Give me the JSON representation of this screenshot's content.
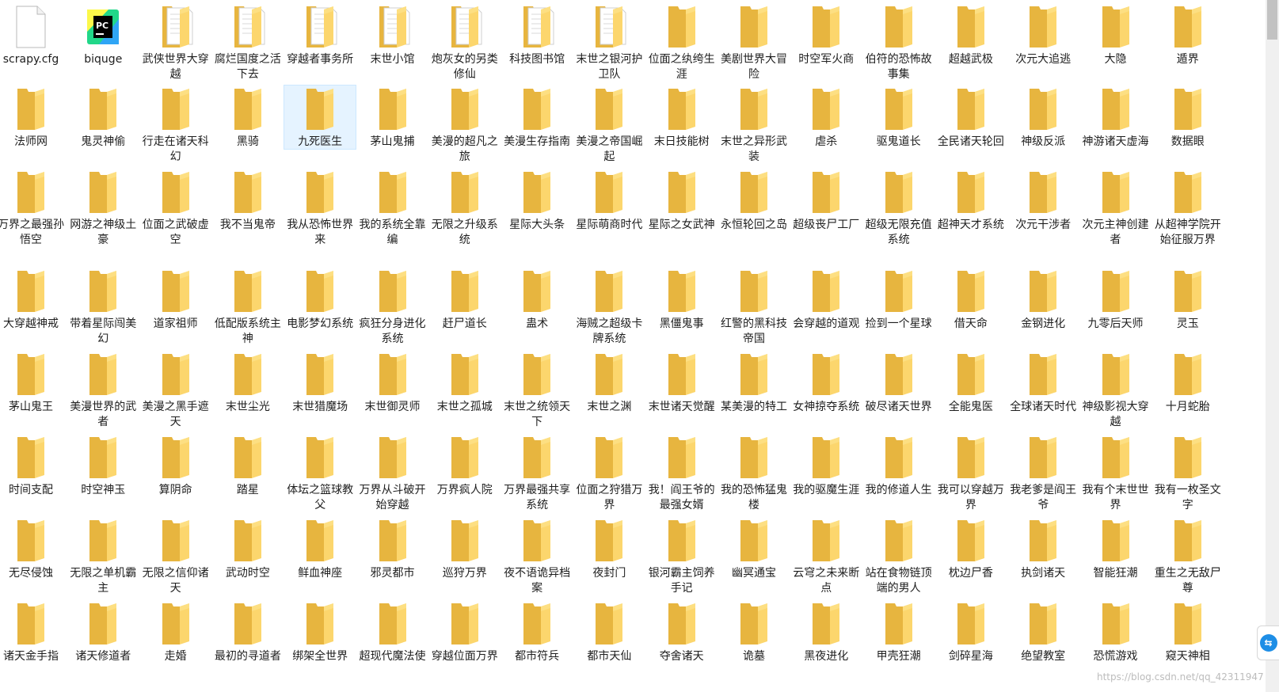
{
  "colors": {
    "folder_back": "#e7b53f",
    "folder_front": "#fcd66d",
    "folder_front_light": "#fde28b",
    "paper": "#ffffff",
    "selection": "#e5f3ff"
  },
  "items": [
    {
      "label": "scrapy.cfg",
      "type": "file"
    },
    {
      "label": "biquge",
      "type": "app"
    },
    {
      "label": "武侠世界大穿越",
      "type": "folder-doc"
    },
    {
      "label": "腐烂国度之活下去",
      "type": "folder-doc"
    },
    {
      "label": "穿越者事务所",
      "type": "folder-doc"
    },
    {
      "label": "末世小馆",
      "type": "folder-doc"
    },
    {
      "label": "炮灰女的另类修仙",
      "type": "folder-doc"
    },
    {
      "label": "科技图书馆",
      "type": "folder-doc"
    },
    {
      "label": "末世之银河护卫队",
      "type": "folder-doc"
    },
    {
      "label": "位面之纨绔生涯",
      "type": "folder"
    },
    {
      "label": "美剧世界大冒险",
      "type": "folder"
    },
    {
      "label": "时空军火商",
      "type": "folder"
    },
    {
      "label": "伯符的恐怖故事集",
      "type": "folder"
    },
    {
      "label": "超越武极",
      "type": "folder"
    },
    {
      "label": "次元大追逃",
      "type": "folder"
    },
    {
      "label": "大隐",
      "type": "folder"
    },
    {
      "label": "遁界",
      "type": "folder"
    },
    {
      "label": "法师网",
      "type": "folder"
    },
    {
      "label": "鬼灵神偷",
      "type": "folder"
    },
    {
      "label": "行走在诸天科幻",
      "type": "folder"
    },
    {
      "label": "黑骑",
      "type": "folder"
    },
    {
      "label": "九死医生",
      "type": "folder",
      "selected": true
    },
    {
      "label": "茅山鬼捕",
      "type": "folder"
    },
    {
      "label": "美漫的超凡之旅",
      "type": "folder"
    },
    {
      "label": "美漫生存指南",
      "type": "folder"
    },
    {
      "label": "美漫之帝国崛起",
      "type": "folder"
    },
    {
      "label": "末日技能树",
      "type": "folder"
    },
    {
      "label": "末世之异形武装",
      "type": "folder"
    },
    {
      "label": "虐杀",
      "type": "folder"
    },
    {
      "label": "驱鬼道长",
      "type": "folder"
    },
    {
      "label": "全民诸天轮回",
      "type": "folder"
    },
    {
      "label": "神级反派",
      "type": "folder"
    },
    {
      "label": "神游诸天虚海",
      "type": "folder"
    },
    {
      "label": "数据眼",
      "type": "folder"
    },
    {
      "label": "万界之最强孙悟空",
      "type": "folder"
    },
    {
      "label": "网游之神级土豪",
      "type": "folder"
    },
    {
      "label": "位面之武破虚空",
      "type": "folder"
    },
    {
      "label": "我不当鬼帝",
      "type": "folder"
    },
    {
      "label": "我从恐怖世界来",
      "type": "folder"
    },
    {
      "label": "我的系统全靠编",
      "type": "folder"
    },
    {
      "label": "无限之升级系统",
      "type": "folder"
    },
    {
      "label": "星际大头条",
      "type": "folder"
    },
    {
      "label": "星际萌商时代",
      "type": "folder"
    },
    {
      "label": "星际之女武神",
      "type": "folder"
    },
    {
      "label": "永恒轮回之岛",
      "type": "folder"
    },
    {
      "label": "超级丧尸工厂",
      "type": "folder"
    },
    {
      "label": "超级无限充值系统",
      "type": "folder"
    },
    {
      "label": "超神天才系统",
      "type": "folder"
    },
    {
      "label": "次元干涉者",
      "type": "folder"
    },
    {
      "label": "次元主神创建者",
      "type": "folder"
    },
    {
      "label": "从超神学院开始征服万界",
      "type": "folder"
    },
    {
      "label": "大穿越神戒",
      "type": "folder"
    },
    {
      "label": "带着星际闯美幻",
      "type": "folder"
    },
    {
      "label": "道家祖师",
      "type": "folder"
    },
    {
      "label": "低配版系统主神",
      "type": "folder"
    },
    {
      "label": "电影梦幻系统",
      "type": "folder"
    },
    {
      "label": "疯狂分身进化系统",
      "type": "folder"
    },
    {
      "label": "赶尸道长",
      "type": "folder"
    },
    {
      "label": "蛊术",
      "type": "folder"
    },
    {
      "label": "海贼之超级卡牌系统",
      "type": "folder"
    },
    {
      "label": "黑僵鬼事",
      "type": "folder"
    },
    {
      "label": "红警的黑科技帝国",
      "type": "folder"
    },
    {
      "label": "会穿越的道观",
      "type": "folder"
    },
    {
      "label": "捡到一个星球",
      "type": "folder"
    },
    {
      "label": "借天命",
      "type": "folder"
    },
    {
      "label": "金钢进化",
      "type": "folder"
    },
    {
      "label": "九零后天师",
      "type": "folder"
    },
    {
      "label": "灵玉",
      "type": "folder"
    },
    {
      "label": "茅山鬼王",
      "type": "folder"
    },
    {
      "label": "美漫世界的武者",
      "type": "folder"
    },
    {
      "label": "美漫之黑手遮天",
      "type": "folder"
    },
    {
      "label": "末世尘光",
      "type": "folder"
    },
    {
      "label": "末世猎魔场",
      "type": "folder"
    },
    {
      "label": "末世御灵师",
      "type": "folder"
    },
    {
      "label": "末世之孤城",
      "type": "folder"
    },
    {
      "label": "末世之统领天下",
      "type": "folder"
    },
    {
      "label": "末世之渊",
      "type": "folder"
    },
    {
      "label": "末世诸天觉醒",
      "type": "folder"
    },
    {
      "label": "某美漫的特工",
      "type": "folder"
    },
    {
      "label": "女神掠夺系统",
      "type": "folder"
    },
    {
      "label": "破尽诸天世界",
      "type": "folder"
    },
    {
      "label": "全能鬼医",
      "type": "folder"
    },
    {
      "label": "全球诸天时代",
      "type": "folder"
    },
    {
      "label": "神级影视大穿越",
      "type": "folder"
    },
    {
      "label": "十月蛇胎",
      "type": "folder"
    },
    {
      "label": "时间支配",
      "type": "folder"
    },
    {
      "label": "时空神玉",
      "type": "folder"
    },
    {
      "label": "算阴命",
      "type": "folder"
    },
    {
      "label": "踏星",
      "type": "folder"
    },
    {
      "label": "体坛之篮球教父",
      "type": "folder"
    },
    {
      "label": "万界从斗破开始穿越",
      "type": "folder"
    },
    {
      "label": "万界疯人院",
      "type": "folder"
    },
    {
      "label": "万界最强共享系统",
      "type": "folder"
    },
    {
      "label": "位面之狩猎万界",
      "type": "folder"
    },
    {
      "label": "我！阎王爷的最强女婿",
      "type": "folder"
    },
    {
      "label": "我的恐怖猛鬼楼",
      "type": "folder"
    },
    {
      "label": "我的驱魔生涯",
      "type": "folder"
    },
    {
      "label": "我的修道人生",
      "type": "folder"
    },
    {
      "label": "我可以穿越万界",
      "type": "folder"
    },
    {
      "label": "我老爹是阎王爷",
      "type": "folder"
    },
    {
      "label": "我有个末世世界",
      "type": "folder"
    },
    {
      "label": "我有一枚圣文字",
      "type": "folder"
    },
    {
      "label": "无尽侵蚀",
      "type": "folder"
    },
    {
      "label": "无限之单机霸主",
      "type": "folder"
    },
    {
      "label": "无限之信仰诸天",
      "type": "folder"
    },
    {
      "label": "武动时空",
      "type": "folder"
    },
    {
      "label": "鲜血神座",
      "type": "folder"
    },
    {
      "label": "邪灵都市",
      "type": "folder"
    },
    {
      "label": "巡狩万界",
      "type": "folder"
    },
    {
      "label": "夜不语诡异档案",
      "type": "folder"
    },
    {
      "label": "夜封门",
      "type": "folder"
    },
    {
      "label": "银河霸主饲养手记",
      "type": "folder"
    },
    {
      "label": "幽冥通宝",
      "type": "folder"
    },
    {
      "label": "云穹之未来断点",
      "type": "folder"
    },
    {
      "label": "站在食物链顶端的男人",
      "type": "folder"
    },
    {
      "label": "枕边尸香",
      "type": "folder"
    },
    {
      "label": "执剑诸天",
      "type": "folder"
    },
    {
      "label": "智能狂潮",
      "type": "folder"
    },
    {
      "label": "重生之无敌尸尊",
      "type": "folder"
    },
    {
      "label": "诸天金手指",
      "type": "folder"
    },
    {
      "label": "诸天修道者",
      "type": "folder"
    },
    {
      "label": "走婚",
      "type": "folder"
    },
    {
      "label": "最初的寻道者",
      "type": "folder"
    },
    {
      "label": "绑架全世界",
      "type": "folder"
    },
    {
      "label": "超现代魔法使",
      "type": "folder"
    },
    {
      "label": "穿越位面万界",
      "type": "folder"
    },
    {
      "label": "都市符兵",
      "type": "folder"
    },
    {
      "label": "都市天仙",
      "type": "folder"
    },
    {
      "label": "夺舍诸天",
      "type": "folder"
    },
    {
      "label": "诡墓",
      "type": "folder"
    },
    {
      "label": "黑夜进化",
      "type": "folder"
    },
    {
      "label": "甲壳狂潮",
      "type": "folder"
    },
    {
      "label": "剑碎星海",
      "type": "folder"
    },
    {
      "label": "绝望教室",
      "type": "folder"
    },
    {
      "label": "恐慌游戏",
      "type": "folder"
    },
    {
      "label": "窥天神相",
      "type": "folder"
    }
  ],
  "watermark": "https://blog.csdn.net/qq_42311947",
  "side_widget": {
    "icon": "remote-assist-icon"
  }
}
